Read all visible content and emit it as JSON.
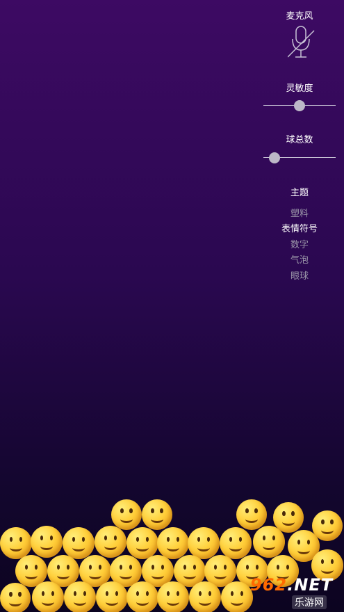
{
  "panel": {
    "microphone": {
      "label": "麦克风",
      "icon": "microphone-muted-icon",
      "muted": true
    },
    "sensitivity": {
      "label": "灵敏度",
      "value": 0.5
    },
    "ball_count": {
      "label": "球总数",
      "value": 0.15
    },
    "theme": {
      "label": "主题",
      "options": [
        "塑料",
        "表情符号",
        "数字",
        "气泡",
        "眼球"
      ],
      "selected": "表情符号"
    }
  },
  "colors": {
    "background_top": "#3d0a63",
    "background_bottom": "#0c0420",
    "inactive_text": "#9a95a8",
    "active_text": "#ffffff"
  },
  "watermark": {
    "brand": "962",
    "suffix": ".NET",
    "caption": "乐游网"
  }
}
